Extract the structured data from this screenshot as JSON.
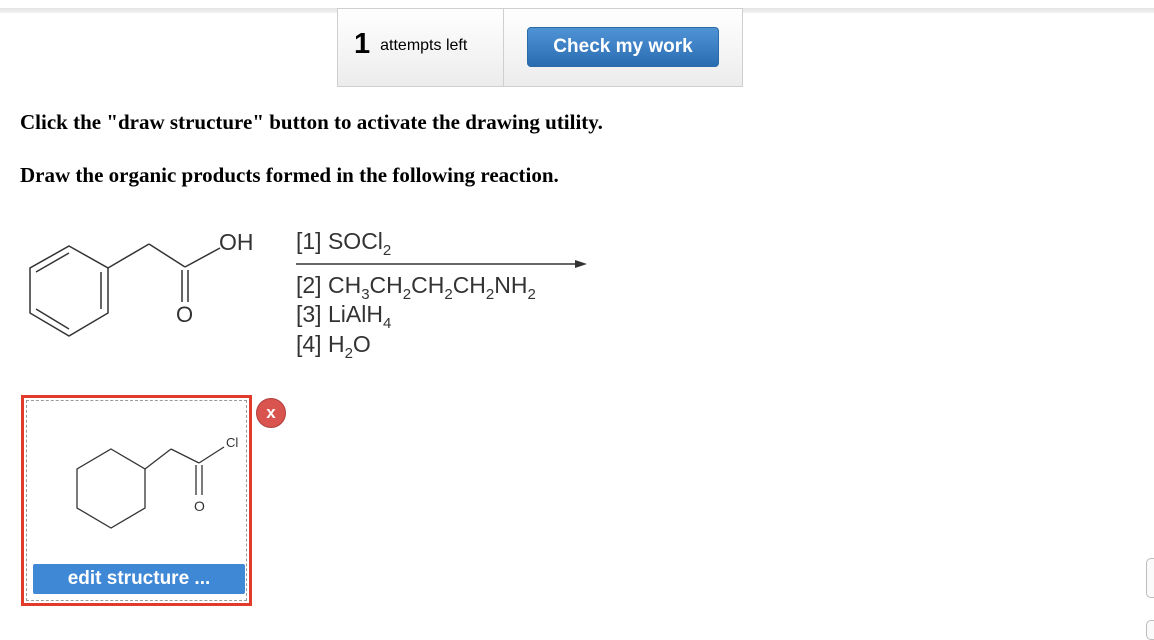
{
  "attempts": {
    "count": "1",
    "label": "attempts left"
  },
  "check_button": {
    "label": "Check my work"
  },
  "instructions": {
    "line1": "Click the \"draw structure\" button to activate the drawing utility.",
    "line2": "Draw the organic products formed in the following reaction."
  },
  "reaction": {
    "reactant": {
      "oh": "OH",
      "o": "O"
    },
    "conditions": {
      "step1": {
        "prefix": "[1] SOCl",
        "sub": "2"
      },
      "step2": {
        "prefix": "[2] CH",
        "parts": [
          {
            "sub": "3",
            "text": "CH"
          },
          {
            "sub": "2",
            "text": "CH"
          },
          {
            "sub": "2",
            "text": "CH"
          },
          {
            "sub": "2",
            "text": "NH"
          },
          {
            "sub": "2",
            "text": ""
          }
        ]
      },
      "step3": {
        "prefix": "[3] LiAlH",
        "sub": "4"
      },
      "step4": {
        "prefix": "[4] H",
        "sub": "2",
        "suffix": "O"
      }
    }
  },
  "answer": {
    "cl_label": "Cl",
    "o_label": "O",
    "edit_label": "edit structure ...",
    "remove_label": "x"
  },
  "colors": {
    "accent": "#3f88d6",
    "error_border": "#e03b2b",
    "remove": "#d9534f"
  }
}
